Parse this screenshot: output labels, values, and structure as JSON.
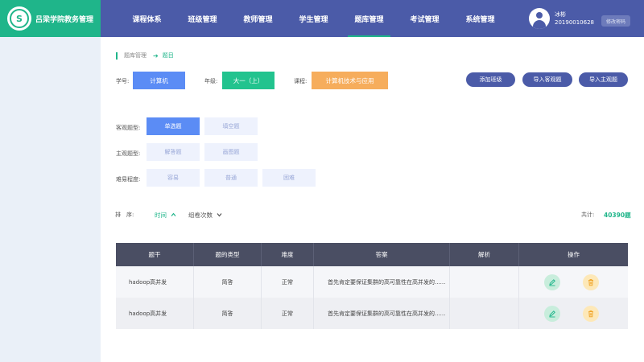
{
  "brand": {
    "name": "吕梁学院教务管理",
    "logo_text": "S"
  },
  "nav": [
    {
      "label": "课程体系"
    },
    {
      "label": "班级管理"
    },
    {
      "label": "教师管理"
    },
    {
      "label": "学生管理"
    },
    {
      "label": "题库管理",
      "active": true
    },
    {
      "label": "考试管理"
    },
    {
      "label": "系统管理"
    }
  ],
  "user": {
    "name": "冰彬",
    "id": "20190010628",
    "change_password": "修改密码"
  },
  "breadcrumb": {
    "parent": "题库管理",
    "arrow": "➔",
    "current": "题目"
  },
  "filters": {
    "major_label": "学号:",
    "major_value": "计算机",
    "grade_label": "年级:",
    "grade_value": "大一（上）",
    "course_label": "课程:",
    "course_value": "计算机技术与应用"
  },
  "actions": {
    "add_class": "添加班级",
    "import_objective": "导入客观题",
    "import_subjective": "导入主观题"
  },
  "objective": {
    "label": "客观题型:",
    "options": [
      "单选题",
      "填空题"
    ]
  },
  "subjective": {
    "label": "主观题型:",
    "options": [
      "解答题",
      "画图题"
    ]
  },
  "difficulty": {
    "label": "难易程度:",
    "options": [
      "容易",
      "普通",
      "困难"
    ]
  },
  "sort": {
    "label": "排　序:",
    "time": "时间",
    "views": "组卷次数"
  },
  "total": {
    "label": "共计:",
    "value": "40390题"
  },
  "table": {
    "headers": [
      "题干",
      "题的类型",
      "难度",
      "答案",
      "解析",
      "操作"
    ],
    "rows": [
      {
        "stem": "hadoop高并发",
        "type": "简答",
        "difficulty": "正常",
        "answer": "首先肯定要保证集群的高可靠性在高并发的......",
        "analysis": ""
      },
      {
        "stem": "hadoop高并发",
        "type": "简答",
        "difficulty": "正常",
        "answer": "首先肯定要保证集群的高可靠性在高并发的......",
        "analysis": ""
      }
    ]
  },
  "colors": {
    "header": "#4b5ba8",
    "brand": "#1fb58a",
    "blue": "#5b8cf5",
    "green": "#22c38e",
    "orange": "#f6ad5c",
    "table_head": "#4a4e63"
  }
}
